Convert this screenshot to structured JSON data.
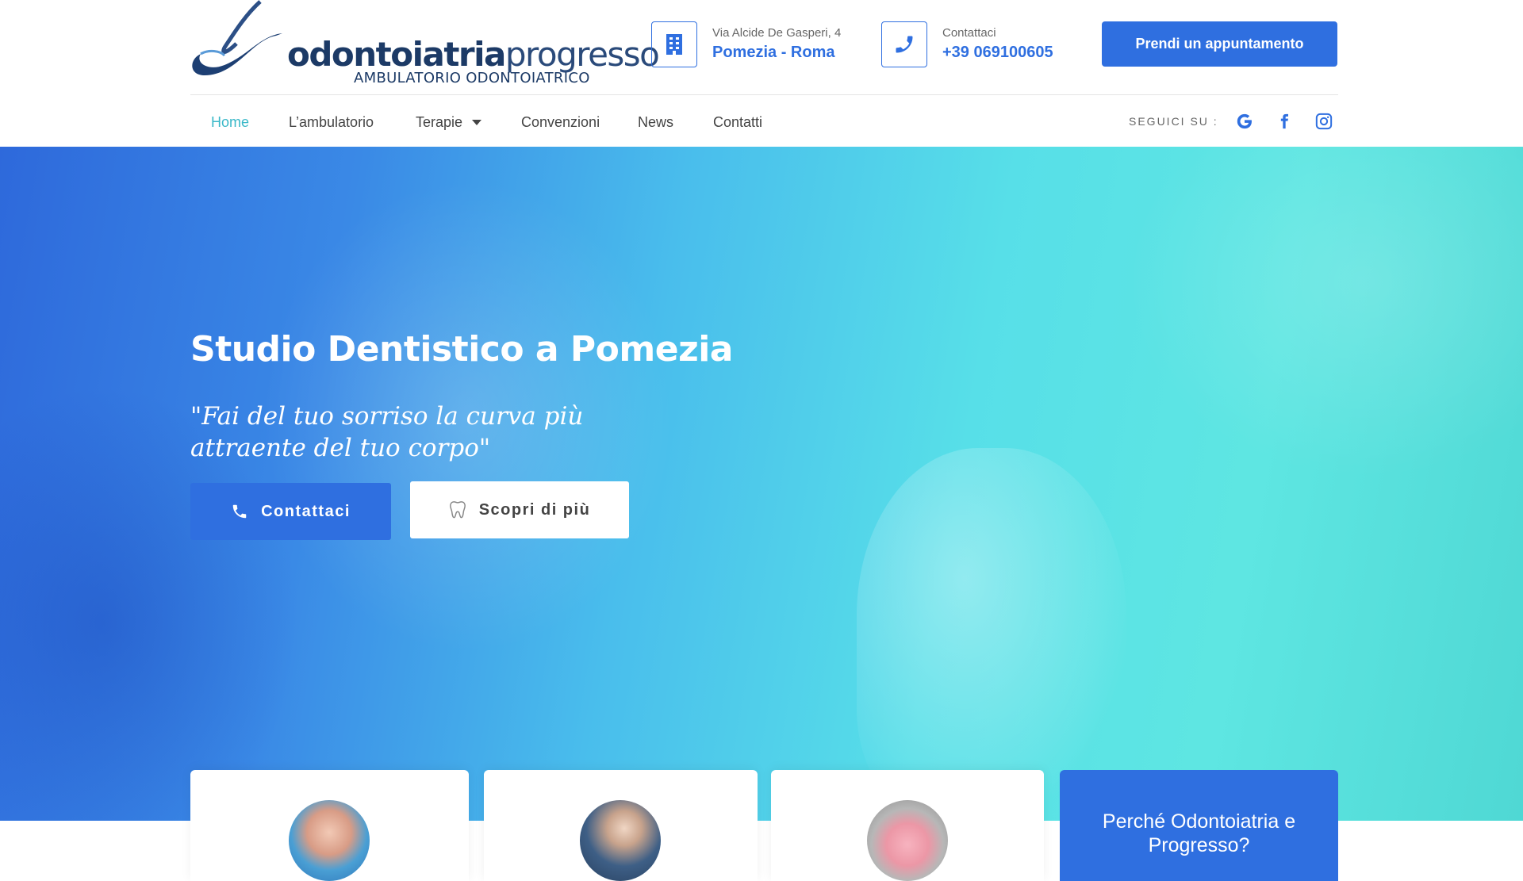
{
  "header": {
    "logo": {
      "brand_bold": "odontoiatria",
      "brand_light": "progresso",
      "subtitle": "AMBULATORIO ODONTOIATRICO"
    },
    "address": {
      "icon": "building-icon",
      "line1": "Via Alcide De Gasperi, 4",
      "line2": "Pomezia - Roma"
    },
    "contact": {
      "icon": "phone-icon",
      "line1": "Contattaci",
      "line2": "+39 069100605"
    },
    "cta_label": "Prendi un appuntamento"
  },
  "nav": {
    "items": [
      {
        "label": "Home",
        "active": true
      },
      {
        "label": "L’ambulatorio"
      },
      {
        "label": "Terapie",
        "has_dropdown": true
      },
      {
        "label": "Convenzioni"
      },
      {
        "label": "News"
      },
      {
        "label": "Contatti"
      }
    ],
    "follow_label": "SEGUICI SU :",
    "social": [
      "google-icon",
      "facebook-icon",
      "instagram-icon"
    ]
  },
  "hero": {
    "title": "Studio Dentistico a Pomezia",
    "quote": "\"Fai del tuo sorriso la curva più attraente del tuo corpo\"",
    "primary_button": "Contattaci",
    "secondary_button": "Scopri di più"
  },
  "cards": {
    "why_title": "Perché Odontoiatria e Progresso?"
  },
  "colors": {
    "accent": "#2f6fe0",
    "nav_active": "#3ab8c8",
    "hero_start": "#2e69db",
    "hero_end": "#5ee6e2"
  }
}
